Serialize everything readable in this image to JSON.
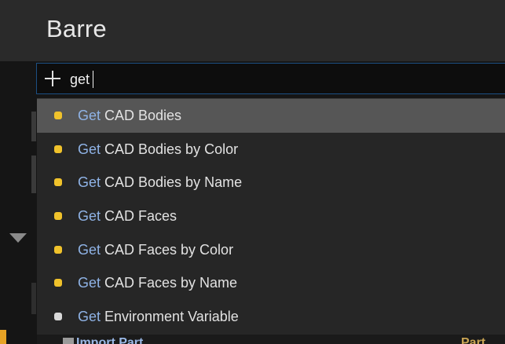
{
  "header": {
    "title": "Barre"
  },
  "search": {
    "query": "get"
  },
  "results": [
    {
      "match": "Get",
      "rest": " CAD Bodies",
      "dot_color": "#f0c22b",
      "selected": true
    },
    {
      "match": "Get",
      "rest": " CAD Bodies by Color",
      "dot_color": "#f0c22b",
      "selected": false
    },
    {
      "match": "Get",
      "rest": " CAD Bodies by Name",
      "dot_color": "#f0c22b",
      "selected": false
    },
    {
      "match": "Get",
      "rest": " CAD Faces",
      "dot_color": "#f0c22b",
      "selected": false
    },
    {
      "match": "Get",
      "rest": " CAD Faces by Color",
      "dot_color": "#f0c22b",
      "selected": false
    },
    {
      "match": "Get",
      "rest": " CAD Faces by Name",
      "dot_color": "#f0c22b",
      "selected": false
    },
    {
      "match": "Get",
      "rest": " Environment Variable",
      "dot_color": "#d9d9d9",
      "selected": false
    }
  ],
  "background": {
    "item_label": "Import Part",
    "item_right_label": "Part"
  },
  "colors": {
    "match_highlight": "#8fb3e6",
    "selection": "#565656",
    "accent_border": "#1c4f83"
  }
}
